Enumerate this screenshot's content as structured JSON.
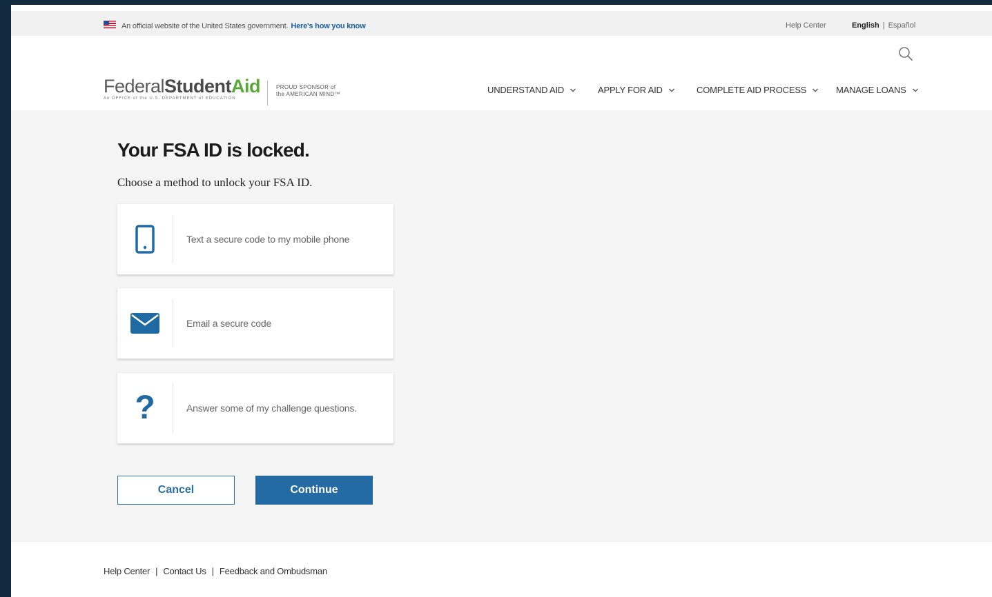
{
  "gov_banner": {
    "text": "An official website of the United States government.",
    "link": "Here's how you know",
    "help_center": "Help Center",
    "lang_english": "English",
    "lang_separator": "|",
    "lang_spanish": "Español"
  },
  "header": {
    "logo_federal": "Federal",
    "logo_student": "Student",
    "logo_aid": "Aid",
    "logo_subtitle": "An OFFICE of the U.S. DEPARTMENT of EDUCATION",
    "sponsor_line1": "PROUD SPONSOR of",
    "sponsor_line2": "the AMERICAN MIND™",
    "nav": [
      {
        "label": "UNDERSTAND AID"
      },
      {
        "label": "APPLY FOR AID"
      },
      {
        "label": "COMPLETE AID PROCESS"
      },
      {
        "label": "MANAGE LOANS"
      }
    ]
  },
  "main": {
    "title": "Your FSA ID is locked.",
    "instruction": "Choose a method to unlock your FSA ID.",
    "options": [
      {
        "label": "Text a secure code to my mobile phone",
        "icon": "mobile-phone-icon"
      },
      {
        "label": "Email a secure code",
        "icon": "envelope-icon"
      },
      {
        "label": "Answer some of my challenge questions.",
        "icon": "question-mark-icon",
        "glyph": "?"
      }
    ],
    "cancel_label": "Cancel",
    "continue_label": "Continue"
  },
  "footer": {
    "links": [
      {
        "label": "Help Center"
      },
      {
        "label": "Contact Us"
      },
      {
        "label": "Feedback and Ombudsman"
      }
    ],
    "separator": "|"
  },
  "colors": {
    "accent": "#246aa3",
    "logo_green": "#5aa83a",
    "page_border": "#112a3d",
    "main_background": "#f5f5f5"
  }
}
